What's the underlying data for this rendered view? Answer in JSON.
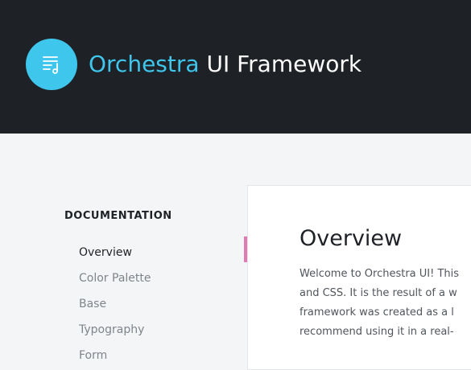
{
  "header": {
    "brand_accent": "Orchestra",
    "brand_rest": " UI Framework",
    "logo_icon": "document-music-icon",
    "colors": {
      "background": "#1e2126",
      "accent": "#3ec6ec"
    }
  },
  "sidebar": {
    "title": "DOCUMENTATION",
    "items": [
      {
        "label": "Overview",
        "active": true
      },
      {
        "label": "Color Palette",
        "active": false
      },
      {
        "label": "Base",
        "active": false
      },
      {
        "label": "Typography",
        "active": false
      },
      {
        "label": "Form",
        "active": false
      }
    ],
    "active_marker_color": "#e17ab1"
  },
  "main": {
    "title": "Overview",
    "body_lines": [
      "Welcome to Orchestra UI! This",
      "and CSS. It is the result of a w",
      "framework was created as a l",
      "recommend using it in a real-"
    ]
  }
}
